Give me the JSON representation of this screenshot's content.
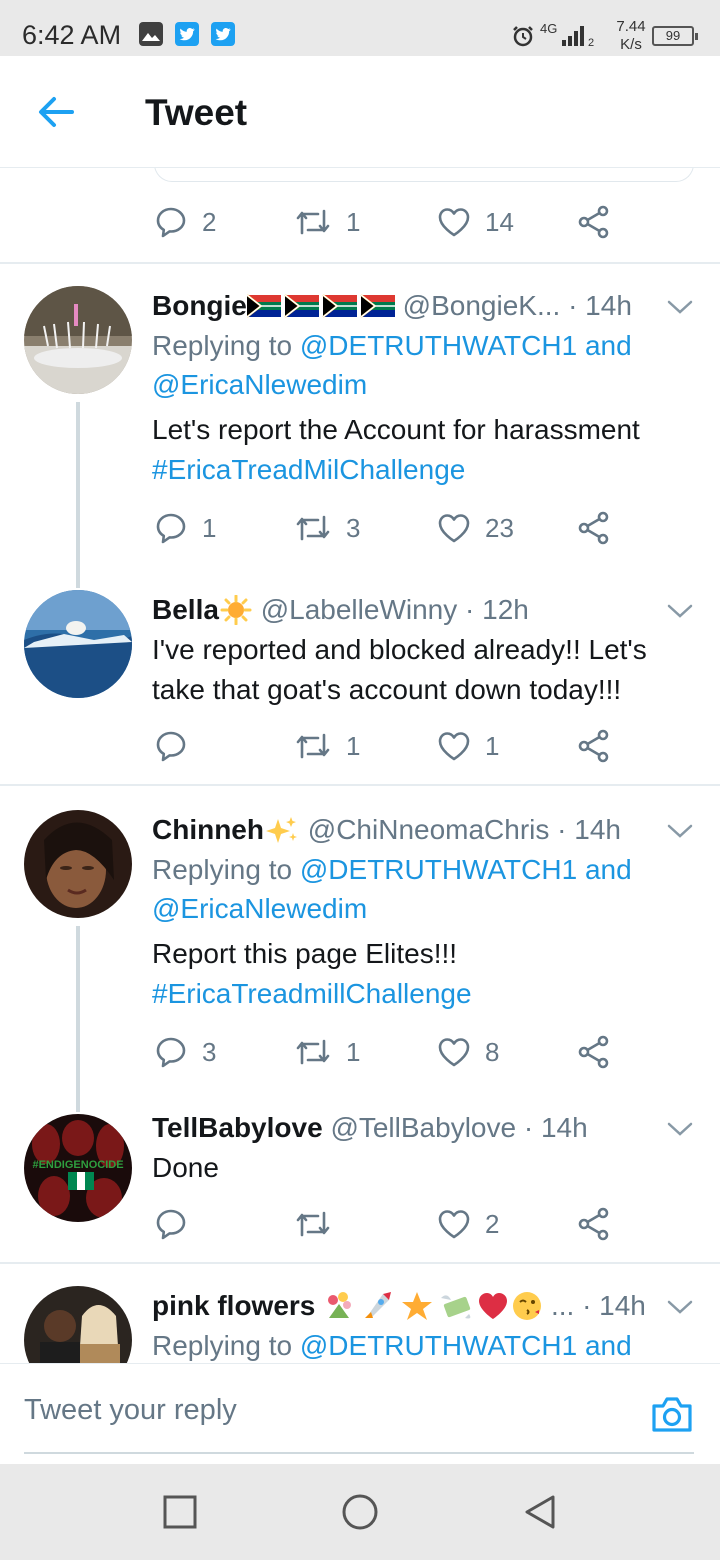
{
  "status_bar": {
    "time": "6:42 AM",
    "network": "4G",
    "sim": "2",
    "speed_value": "7.44",
    "speed_unit": "K/s",
    "battery": "99"
  },
  "app_bar": {
    "title": "Tweet",
    "back_icon": "arrow-left-icon"
  },
  "colors": {
    "accent": "#1da1f2",
    "link": "#1b95e0",
    "muted": "#657786",
    "text": "#14171a"
  },
  "main_tweet_actions": {
    "replies": "2",
    "retweets": "1",
    "likes": "14"
  },
  "replies": [
    {
      "name": "Bongie",
      "handle": "@BongieK...",
      "time": "· 14h",
      "replying_prefix": "Replying to",
      "replying_line1_mention": "@DETRUTHWATCH1 and",
      "replying_line2_mention": "@EricaNlewedim",
      "text": "Let's report the Account for harassment",
      "hashtag": "#EricaTreadMilChallenge",
      "replies": "1",
      "retweets": "3",
      "likes": "23"
    },
    {
      "name": "Bella",
      "handle": "@LabelleWinny",
      "time": "· 12h",
      "text_line1": "I've reported and blocked already!! Let's",
      "text_line2": "take that goat's account down today!!!",
      "replies": "",
      "retweets": "1",
      "likes": "1"
    },
    {
      "name": "Chinneh",
      "handle": "@ChiNneomaChris",
      "time": "· 14h",
      "replying_prefix": "Replying to",
      "replying_line1_mention": "@DETRUTHWATCH1 and",
      "replying_line2_mention": "@EricaNlewedim",
      "text": "Report this page Elites!!!",
      "hashtag": "#EricaTreadmillChallenge",
      "replies": "3",
      "retweets": "1",
      "likes": "8"
    },
    {
      "name": "TellBabylove",
      "handle": "@TellBabylove",
      "time": "· 14h",
      "text": "Done",
      "avatar_text": "#ENDIGENOCIDE",
      "replies": "",
      "retweets": "",
      "likes": "2"
    },
    {
      "name": "pink flowers",
      "handle": "...",
      "time": "· 14h",
      "replying_prefix": "Replying to",
      "replying_line1_mention": "@DETRUTHWATCH1 and"
    }
  ],
  "composer": {
    "placeholder": "Tweet your reply",
    "camera_icon": "camera-icon"
  },
  "nav_bar": {
    "recents_icon": "square-icon",
    "home_icon": "circle-icon",
    "back_icon": "triangle-back-icon"
  }
}
